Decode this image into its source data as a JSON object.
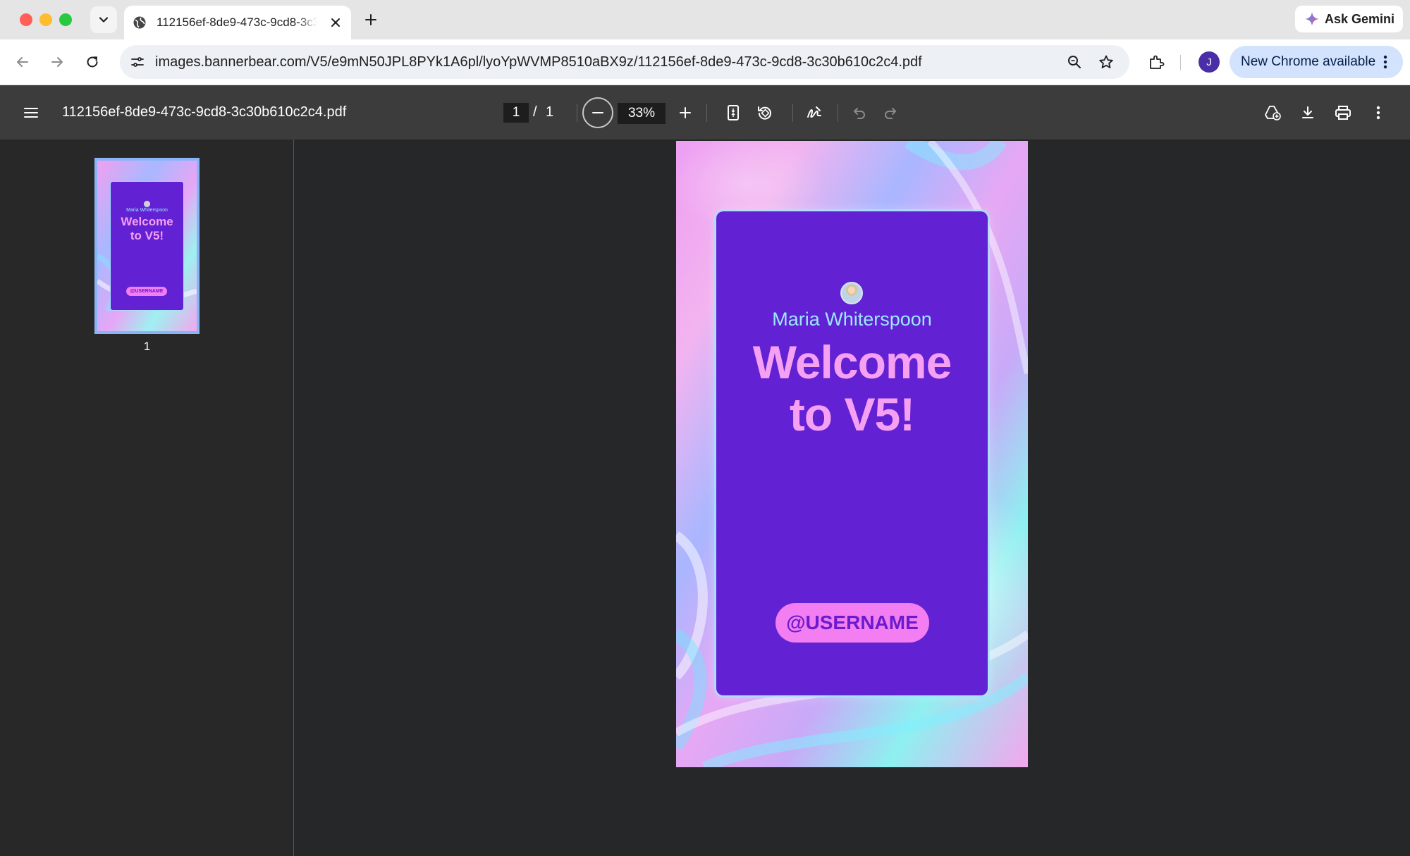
{
  "browser": {
    "tab": {
      "title": "112156ef-8de9-473c-9cd8-3c30b610c2c4.pdf",
      "icon": "globe-icon"
    },
    "ask_gemini": "Ask Gemini",
    "url": "images.bannerbear.com/V5/e9mN50JPL8PYk1A6pl/lyoYpWVMP8510aBX9z/112156ef-8de9-473c-9cd8-3c30b610c2c4.pdf",
    "profile_initial": "J",
    "update_label": "New Chrome available"
  },
  "pdf_viewer": {
    "file_name": "112156ef-8de9-473c-9cd8-3c30b610c2c4.pdf",
    "current_page": "1",
    "page_separator": "/",
    "total_pages": "1",
    "zoom": "33%",
    "thumbnail_label": "1"
  },
  "document": {
    "name": "Maria Whiterspoon",
    "heading_line1": "Welcome",
    "heading_line2": "to V5!",
    "username": "@USERNAME",
    "colors": {
      "card": "#6221d2",
      "heading": "#f6a0f4",
      "name": "#9be8ff",
      "pill": "#f27ef2"
    }
  }
}
